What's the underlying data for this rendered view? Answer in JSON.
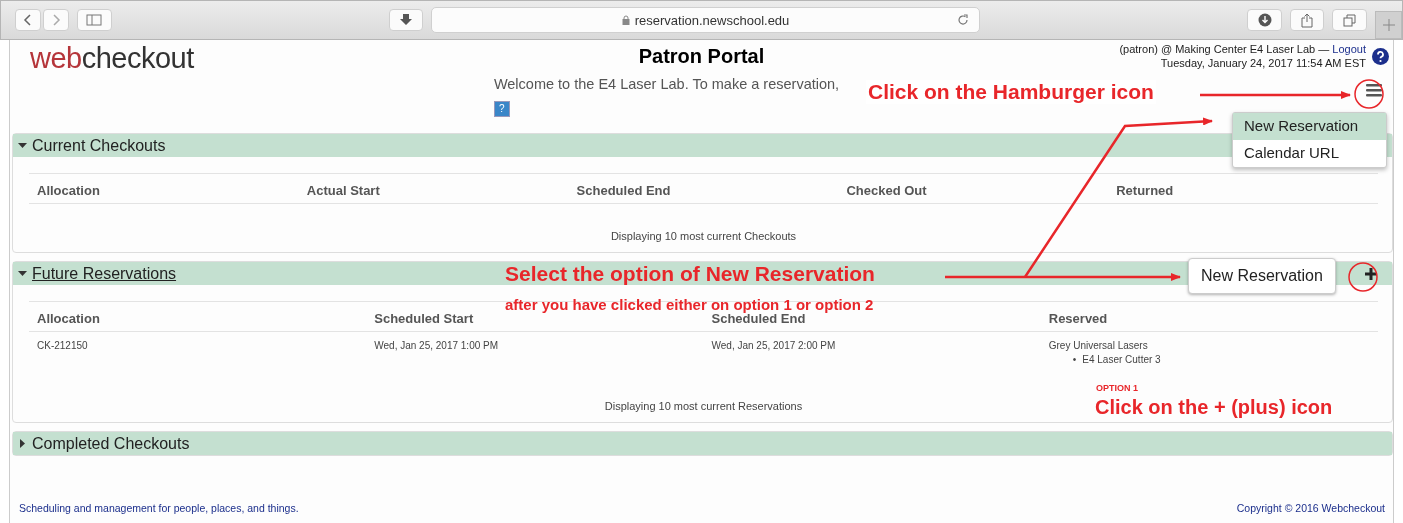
{
  "browser": {
    "url": "reservation.newschool.edu"
  },
  "header": {
    "logo_parts": [
      "web",
      "checkout"
    ],
    "title": "Patron Portal",
    "welcome": "Welcome to the E4 Laser Lab. To make a reservation,",
    "help": "?",
    "user_line": "(patron) @ Making Center E4 Laser Lab —",
    "logout": "Logout",
    "datetime": "Tuesday, January 24, 2017 11:54 AM EST"
  },
  "menu": {
    "items": [
      {
        "label": "New Reservation",
        "selected": true
      },
      {
        "label": "Calendar URL",
        "selected": false
      }
    ]
  },
  "sections": [
    {
      "title": "Current Checkouts",
      "expanded": true,
      "hovered": false,
      "columns": [
        "Allocation",
        "Actual Start",
        "Scheduled End",
        "Checked Out",
        "Returned"
      ],
      "footer": "Displaying 10 most current Checkouts"
    },
    {
      "title": "Future Reservations",
      "expanded": true,
      "hovered": true,
      "columns": [
        "Allocation",
        "Scheduled Start",
        "Scheduled End",
        "Reserved"
      ],
      "rows": [
        {
          "cells": [
            "CK-212150",
            "Wed, Jan 25, 2017 1:00 PM",
            "Wed, Jan 25, 2017 2:00 PM"
          ],
          "reserved": {
            "group": "Grey Universal Lasers",
            "bullet": "•",
            "items": [
              "E4 Laser Cutter 3"
            ]
          }
        }
      ],
      "footer": "Displaying 10 most current Reservations",
      "popup_button": "New Reservation"
    },
    {
      "title": "Completed Checkouts",
      "expanded": false,
      "hovered": false
    }
  ],
  "annotations": {
    "hamburger": "Click on the Hamburger icon",
    "select": "Select the option of New Reservation",
    "select_note": "after you have clicked either on option 1 or option 2",
    "option_label": "OPTION 1",
    "plus": "Click on the + (plus) icon"
  },
  "footer": {
    "left": "Scheduling and management for people, places, and things.",
    "right": "Copyright © 2016 Webcheckout"
  }
}
